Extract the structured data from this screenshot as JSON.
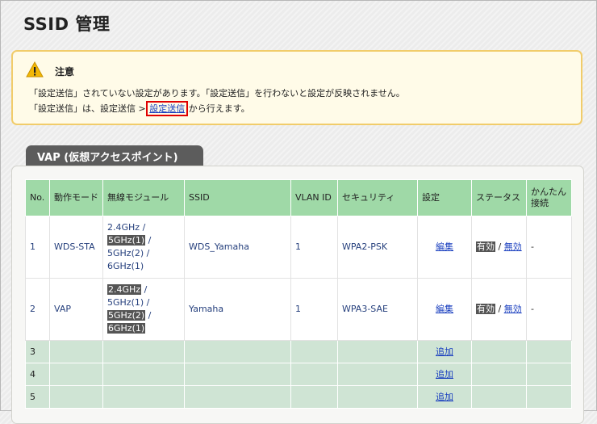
{
  "page": {
    "title": "SSID 管理"
  },
  "notice": {
    "title": "注意",
    "line1": "「設定送信」されていない設定があります。「設定送信」を行わないと設定が反映されません。",
    "line2_prefix": "「設定送信」は、設定送信 > ",
    "line2_link": "設定送信",
    "line2_suffix": " から行えます。",
    "accent_color": "#f1cc6a",
    "link_highlight_color": "#e00000"
  },
  "vap": {
    "tab_label": "VAP (仮想アクセスポイント)",
    "columns": [
      "No.",
      "動作モード",
      "無線モジュール",
      "SSID",
      "VLAN ID",
      "セキュリティ",
      "設定",
      "ステータス",
      "かんたん接続"
    ],
    "rows": [
      {
        "no": "1",
        "mode": "WDS-STA",
        "modules": [
          {
            "text": "2.4GHz",
            "sep": " /",
            "active": false
          },
          {
            "text": "5GHz(1)",
            "sep": " /",
            "active": true
          },
          {
            "text": "5GHz(2)",
            "sep": " /",
            "active": false
          },
          {
            "text": "6GHz(1)",
            "sep": "",
            "active": false
          }
        ],
        "ssid": "WDS_Yamaha",
        "vlan": "1",
        "security": "WPA2-PSK",
        "setting": "編集",
        "status_enabled": "有効",
        "status_sep": " / ",
        "status_disabled": "無効",
        "easy": "-"
      },
      {
        "no": "2",
        "mode": "VAP",
        "modules": [
          {
            "text": "2.4GHz",
            "sep": " /",
            "active": true
          },
          {
            "text": "5GHz(1)",
            "sep": " /",
            "active": false
          },
          {
            "text": "5GHz(2)",
            "sep": " /",
            "active": true
          },
          {
            "text": "6GHz(1)",
            "sep": "",
            "active": true
          }
        ],
        "ssid": "Yamaha",
        "vlan": "1",
        "security": "WPA3-SAE",
        "setting": "編集",
        "status_enabled": "有効",
        "status_sep": " / ",
        "status_disabled": "無効",
        "easy": "-"
      }
    ],
    "empty_rows": [
      {
        "no": "3",
        "setting": "追加"
      },
      {
        "no": "4",
        "setting": "追加"
      },
      {
        "no": "5",
        "setting": "追加"
      }
    ],
    "header_color": "#9fd9a7",
    "empty_row_color": "#cfe4d4"
  }
}
